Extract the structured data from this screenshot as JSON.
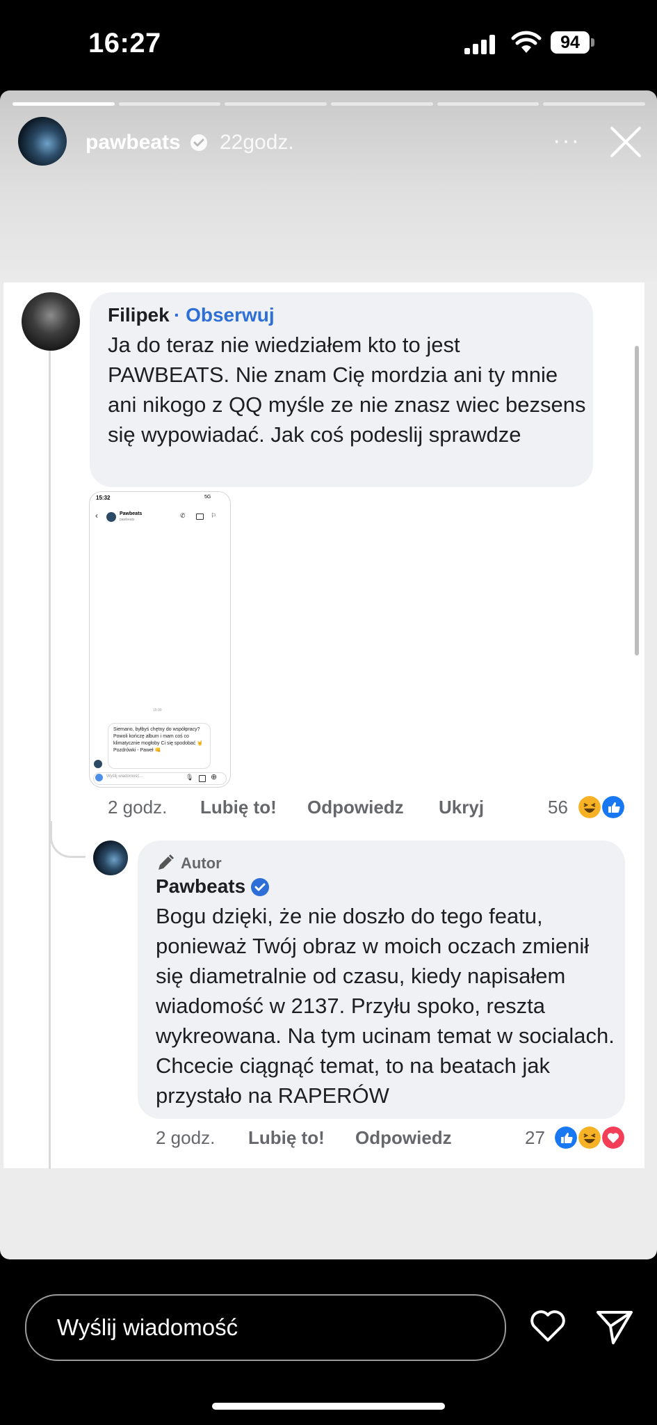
{
  "status_bar": {
    "time": "16:27",
    "battery": "94"
  },
  "story": {
    "username": "pawbeats",
    "time_ago": "22godz.",
    "more": "···",
    "progress_total": 6,
    "progress_active": 1
  },
  "comment1": {
    "name": "Filipek",
    "follow_label": "· Obserwuj",
    "text": "Ja do teraz nie wiedziałem kto to jest PAWBEATS. Nie znam Cię mordzia ani ty mnie ani nikogo z QQ myśle ze nie znasz wiec bezsens się wypowiadać. Jak coś podeslij sprawdze",
    "time": "2 godz.",
    "like_label": "Lubię to!",
    "reply_label": "Odpowiedz",
    "hide_label": "Ukryj",
    "reaction_count": "56",
    "reactions": [
      "haha",
      "like"
    ],
    "attachment": {
      "time": "15:32",
      "status": "5G",
      "contact_name": "Pawbeats",
      "contact_handle": "pawbeats",
      "timestamp": "15:00",
      "message": "Siemano, byłbyś chętny do współpracy? Powoli kończę album i mam coś co klimatycznie mogłoby Ci się spodobać 🤘 Pozdrówki - Paweł 👊",
      "input_placeholder": "Wyślij wiadomość..."
    }
  },
  "comment2": {
    "badge": "Autor",
    "name": "Pawbeats",
    "text": "Bogu dzięki, że nie doszło do tego featu, ponieważ Twój obraz w moich oczach zmienił się diametralnie od czasu, kiedy napisałem wiadomość w 2137. Przyłu spoko, reszta wykreowana. Na tym ucinam temat w socialach. Chcecie ciągnąć temat, to na beatach jak przystało na RAPERÓW",
    "time": "2 godz.",
    "like_label": "Lubię to!",
    "reply_label": "Odpowiedz",
    "reaction_count": "27",
    "reactions": [
      "like",
      "haha",
      "love"
    ]
  },
  "bottom": {
    "message_placeholder": "Wyślij wiadomość"
  },
  "colors": {
    "link_blue": "#2d6fd7",
    "like_blue": "#1877f2",
    "love_red": "#f33e58",
    "haha_yellow": "#f7b125"
  }
}
